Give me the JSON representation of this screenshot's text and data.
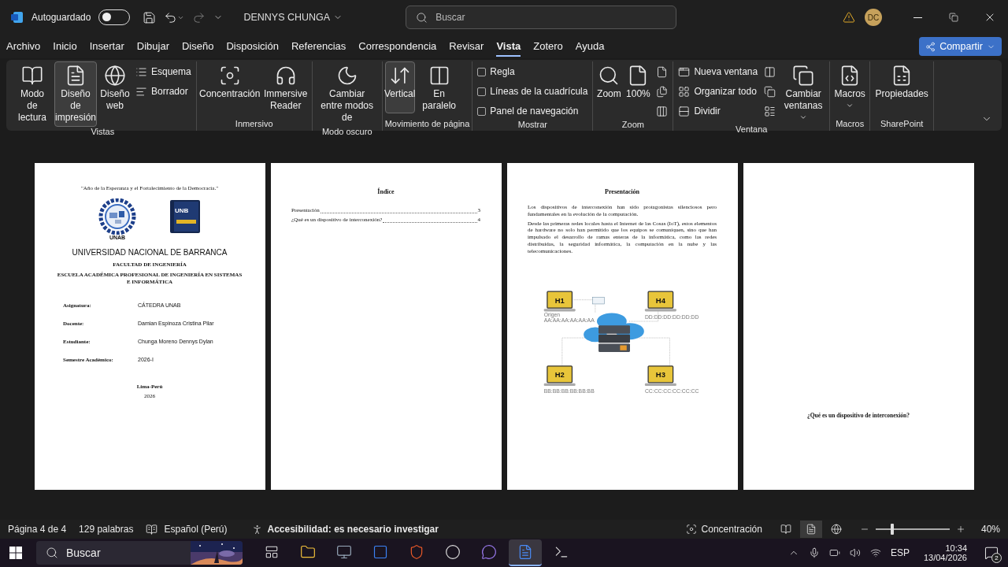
{
  "titlebar": {
    "autosave_label": "Autoguardado",
    "autosave_on": false,
    "document_user": "DENNYS CHUNGA",
    "search": {
      "placeholder": "Buscar"
    },
    "avatar": "DC"
  },
  "menu": [
    {
      "label": "Archivo",
      "selected": false
    },
    {
      "label": "Inicio",
      "selected": false
    },
    {
      "label": "Insertar",
      "selected": false
    },
    {
      "label": "Dibujar",
      "selected": false
    },
    {
      "label": "Diseño",
      "selected": false
    },
    {
      "label": "Disposición",
      "selected": false
    },
    {
      "label": "Referencias",
      "selected": false
    },
    {
      "label": "Correspondencia",
      "selected": false
    },
    {
      "label": "Revisar",
      "selected": false
    },
    {
      "label": "Vista",
      "selected": true
    },
    {
      "label": "Zotero",
      "selected": false
    },
    {
      "label": "Ayuda",
      "selected": false
    }
  ],
  "share": "Compartir",
  "ribbon": [
    {
      "label": "Vistas",
      "items": [
        {
          "kind": "large",
          "label": "Modo de lectura",
          "selected": false
        },
        {
          "kind": "large",
          "label": "Diseño de impresión",
          "selected": true
        },
        {
          "kind": "large",
          "label": "Diseño web",
          "selected": false
        },
        {
          "kind": "small",
          "label": "Esquema"
        },
        {
          "kind": "small",
          "label": "Borrador"
        }
      ]
    },
    {
      "label": "Inmersivo",
      "items": [
        {
          "kind": "large",
          "label": "Concentración"
        },
        {
          "kind": "large",
          "label": "Immersive Reader"
        }
      ]
    },
    {
      "label": "Modo oscuro",
      "items": [
        {
          "kind": "large",
          "label": "Cambiar entre modos de"
        }
      ]
    },
    {
      "label": "Movimiento de página",
      "items": [
        {
          "kind": "large",
          "label": "Vertical",
          "selected": true
        },
        {
          "kind": "large",
          "label": "En paralelo",
          "selected": false
        }
      ]
    },
    {
      "label": "Mostrar",
      "items": [
        {
          "kind": "check",
          "label": "Regla",
          "checked": false
        },
        {
          "kind": "check",
          "label": "Líneas de la cuadrícula",
          "checked": false
        },
        {
          "kind": "check",
          "label": "Panel de navegación",
          "checked": false
        }
      ]
    },
    {
      "label": "Zoom",
      "items": [
        {
          "kind": "large",
          "label": "Zoom"
        },
        {
          "kind": "large",
          "label": "100%"
        },
        {
          "kind": "icon"
        },
        {
          "kind": "icon"
        },
        {
          "kind": "icon"
        }
      ]
    },
    {
      "label": "Ventana",
      "items": [
        {
          "kind": "small",
          "label": "Nueva ventana"
        },
        {
          "kind": "small",
          "label": "Organizar todo"
        },
        {
          "kind": "small",
          "label": "Dividir"
        },
        {
          "kind": "icon"
        },
        {
          "kind": "icon"
        },
        {
          "kind": "icon"
        },
        {
          "kind": "large",
          "label": "Cambiar ventanas",
          "dropdown": true
        }
      ]
    },
    {
      "label": "Macros",
      "items": [
        {
          "kind": "large",
          "label": "Macros",
          "dropdown": true
        }
      ]
    },
    {
      "label": "SharePoint",
      "items": [
        {
          "kind": "large",
          "label": "Propiedades"
        }
      ]
    }
  ],
  "pages": [
    {
      "kind": "cover",
      "motto": "\"Año de la Esperanza y el Fortalecimiento de la Democracia.\"",
      "logo_left": "UNAB",
      "logo_right": "UNB",
      "university": "UNIVERSIDAD NACIONAL DE BARRANCA",
      "faculty": "FACULTAD DE INGENIERÍA",
      "school": "ESCUELA ACADÉMICA PROFESIONAL DE INGENIERÍA EN SISTEMAS E INFORMÁTICA",
      "fields": [
        {
          "label": "Asignatura:",
          "value": "CÁTEDRA UNAB"
        },
        {
          "label": "Docente:",
          "value": "Damian Espinoza Cristina Pilar"
        },
        {
          "label": "Estudiante:",
          "value": "Chunga Moreno Dennys Dylan"
        },
        {
          "label": "Semestre Académico:",
          "value": "2026-I"
        }
      ],
      "place": "Lima-Perú",
      "year": "2026"
    },
    {
      "kind": "toc",
      "title": "Índice",
      "entries": [
        {
          "text": "Presentación",
          "page": "3"
        },
        {
          "text": "¿Qué es un dispositivo de interconexión?",
          "page": "4"
        }
      ]
    },
    {
      "kind": "text",
      "title": "Presentación",
      "paragraphs": [
        "Los dispositivos de interconexión han sido protagonistas silenciosos pero fundamentales en la evolución de la computación.",
        "Desde las primeras redes locales hasta el Internet de las Cosas (IoT), estos elementos de hardware no solo han permitido que los equipos se comuniquen, sino que han impulsado el desarrollo de ramas enteras de la informática, como las redes distribuidas, la seguridad informática, la computación en la nube y las telecomunicaciones."
      ],
      "diagram": {
        "hosts": [
          {
            "label": "H1",
            "note": "Origen",
            "address": "AA:AA:AA:AA:AA:AA"
          },
          {
            "label": "H4",
            "address": "DD:DD:DD:DD:DD:DD"
          },
          {
            "label": "H2",
            "address": "BB:BB:BB:BB:BB:BB"
          },
          {
            "label": "H3",
            "address": "CC:CC:CC:CC:CC:CC"
          }
        ]
      }
    },
    {
      "kind": "heading",
      "title": "¿Qué es un dispositivo de interconexión?"
    }
  ],
  "status": {
    "page": "Página 4 de 4",
    "words": "129 palabras",
    "language": "Español (Perú)",
    "accessibility": "Accesibilidad: es necesario investigar",
    "focus": "Concentración",
    "views": [
      {
        "selected": false
      },
      {
        "selected": true
      },
      {
        "selected": false
      }
    ],
    "zoom": {
      "level": 0.2,
      "reading": "40%"
    }
  },
  "taskbar": {
    "search": {
      "placeholder": "Buscar"
    },
    "apps": [
      {
        "selected": false
      },
      {
        "selected": false
      },
      {
        "selected": false
      },
      {
        "selected": false
      },
      {
        "selected": false
      },
      {
        "selected": false
      },
      {
        "selected": true
      },
      {
        "selected": false
      }
    ],
    "language": "ESP",
    "time": "10:34",
    "date": "13/04/2026",
    "notifications": "2"
  }
}
